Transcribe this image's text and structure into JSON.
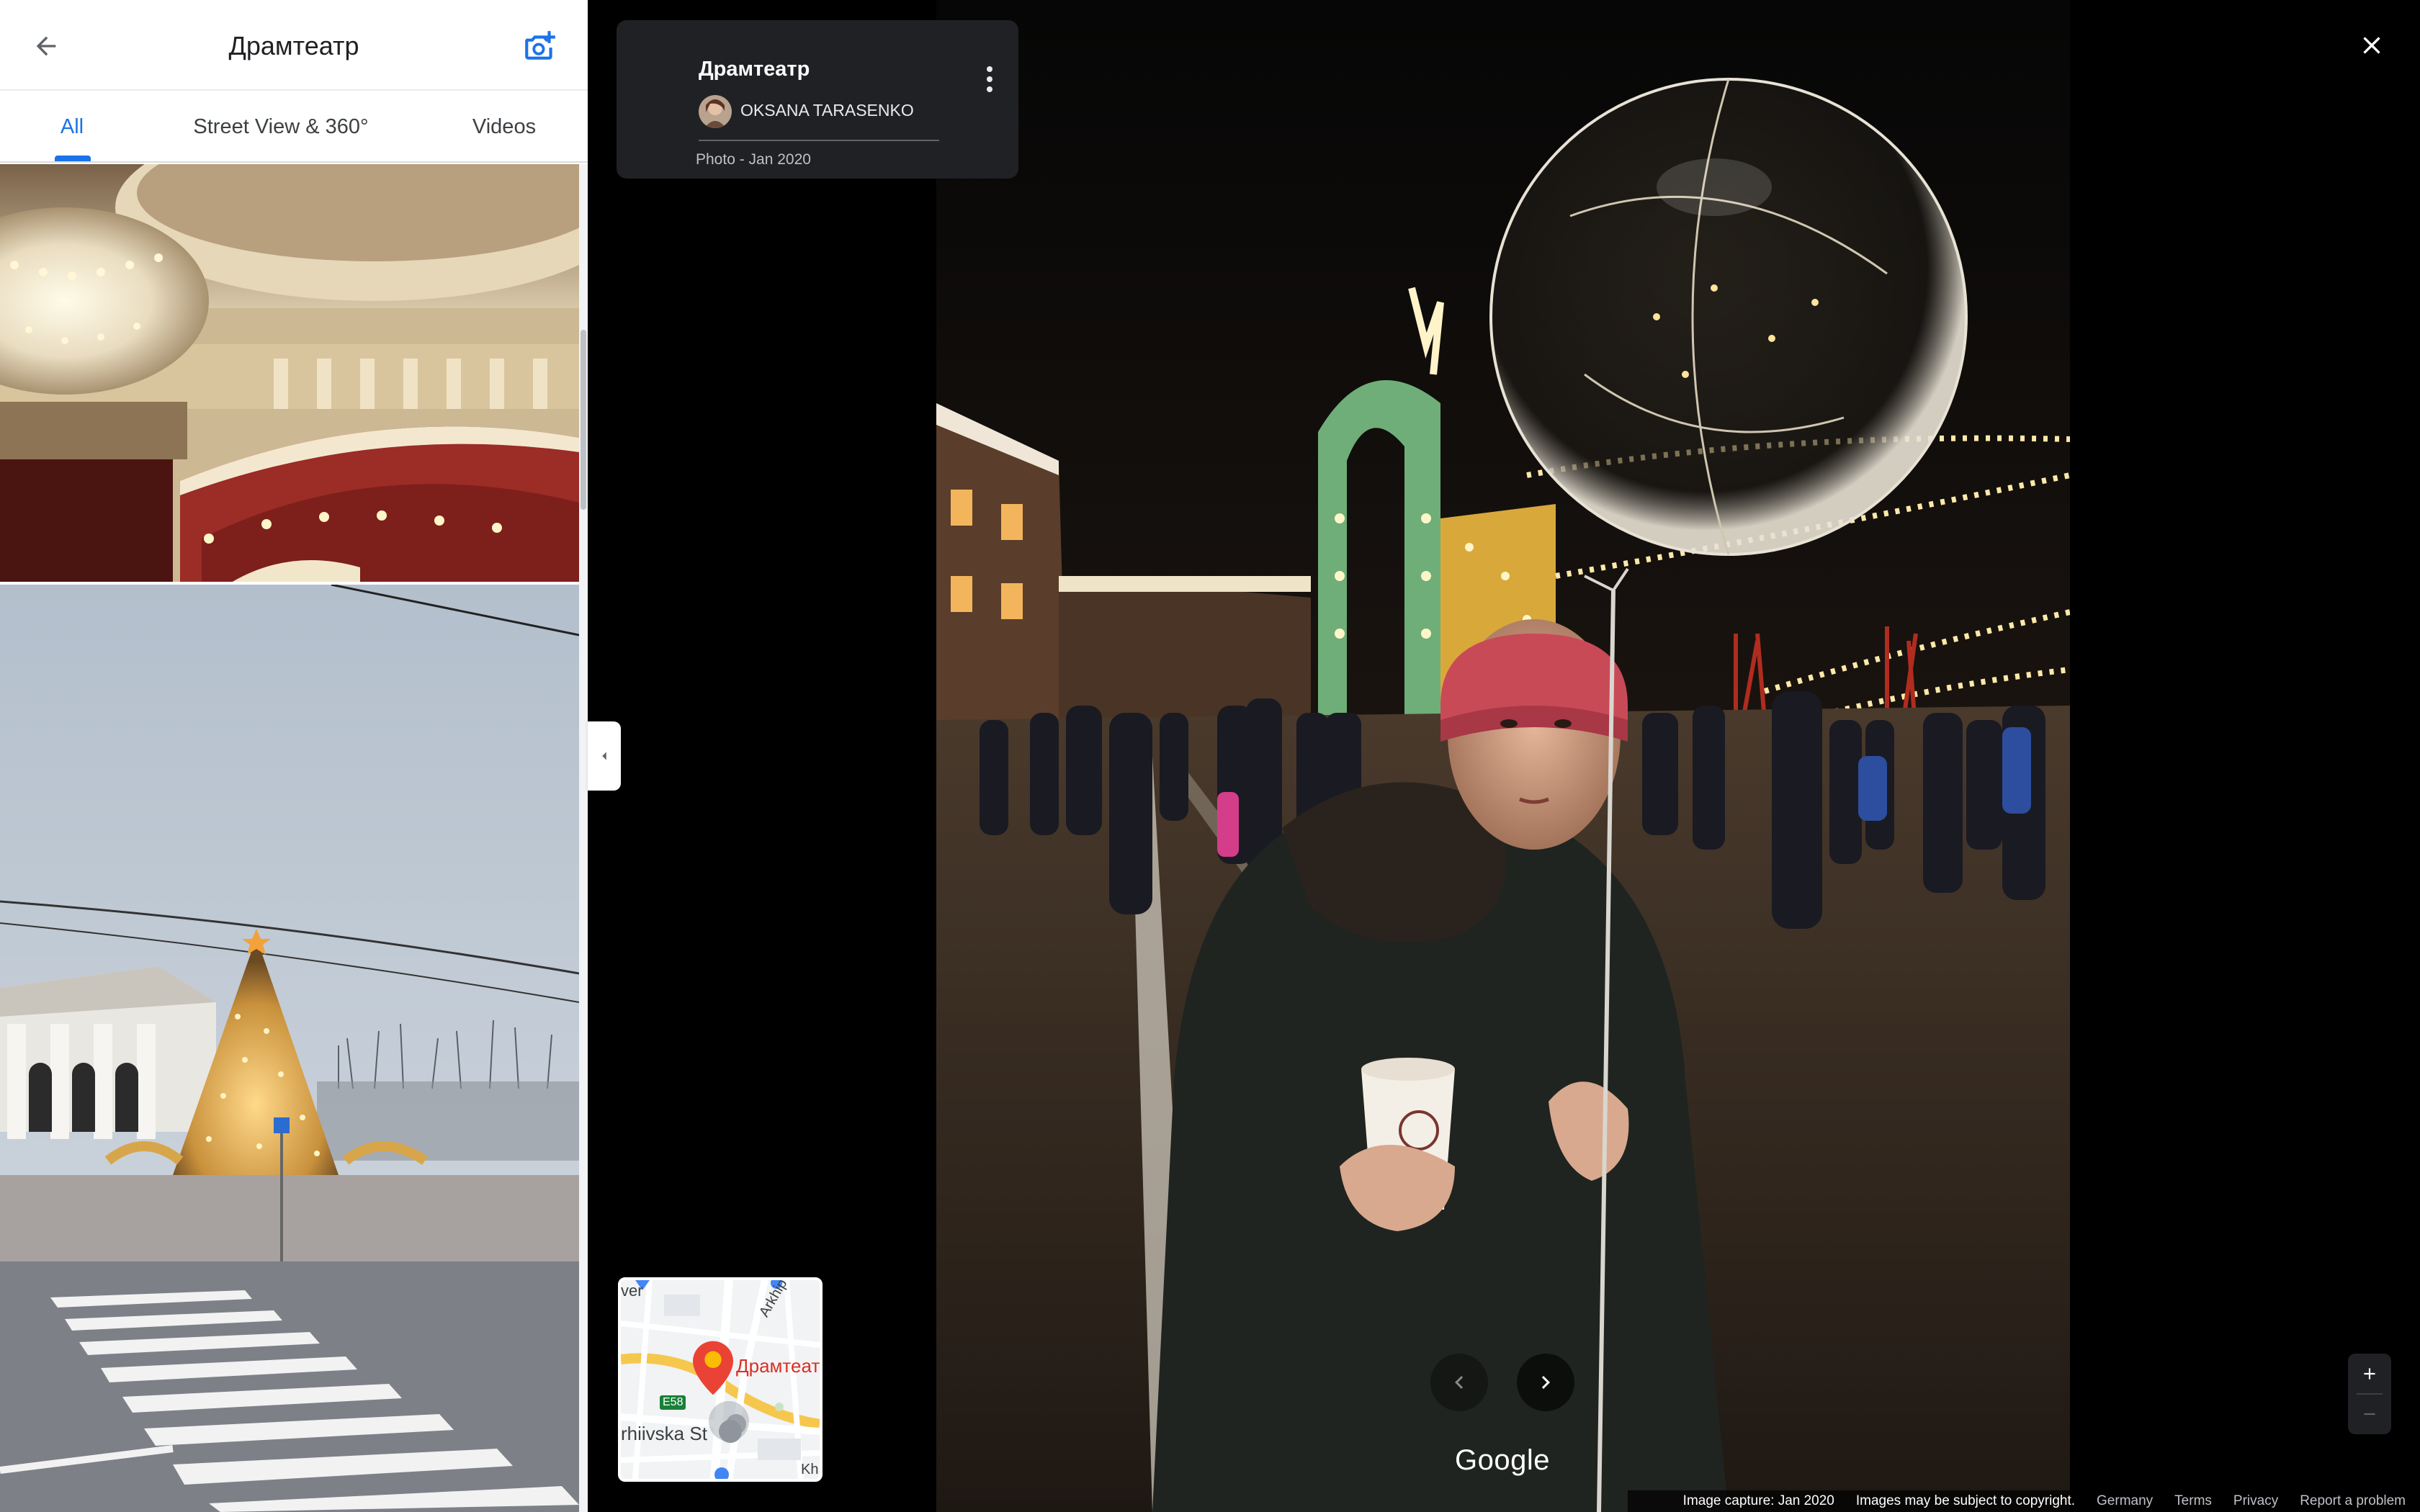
{
  "panel": {
    "title": "Драмтеатр",
    "tabs": [
      {
        "label": "All",
        "active": true
      },
      {
        "label": "Street View & 360°",
        "active": false
      },
      {
        "label": "Videos",
        "active": false
      }
    ]
  },
  "viewer": {
    "card": {
      "place_name": "Драмтеатр",
      "author": "OKSANA TARASENKO",
      "date": "Photo - Jan 2020"
    },
    "minimap": {
      "labels": [
        "ver",
        "Arkhip Ku",
        "Драмтеат",
        "E58",
        "rhiivska St",
        "Kh"
      ]
    },
    "logo": "Google",
    "footer": {
      "capture": "Image capture: Jan 2020",
      "copyright": "Images may be subject to copyright.",
      "links": [
        "Germany",
        "Terms",
        "Privacy",
        "Report a problem"
      ]
    }
  },
  "icons": {
    "back": "arrow-left-icon",
    "add_photo": "camera-plus-icon",
    "collapse": "chevron-left-icon",
    "more": "more-vertical-icon",
    "close": "close-icon",
    "prev": "chevron-left-icon",
    "next": "chevron-right-icon",
    "zoom_in": "plus-icon",
    "zoom_out": "minus-icon"
  },
  "colors": {
    "accent": "#1a73e8",
    "card_bg": "#202124",
    "map_pin": "#ea4335"
  }
}
